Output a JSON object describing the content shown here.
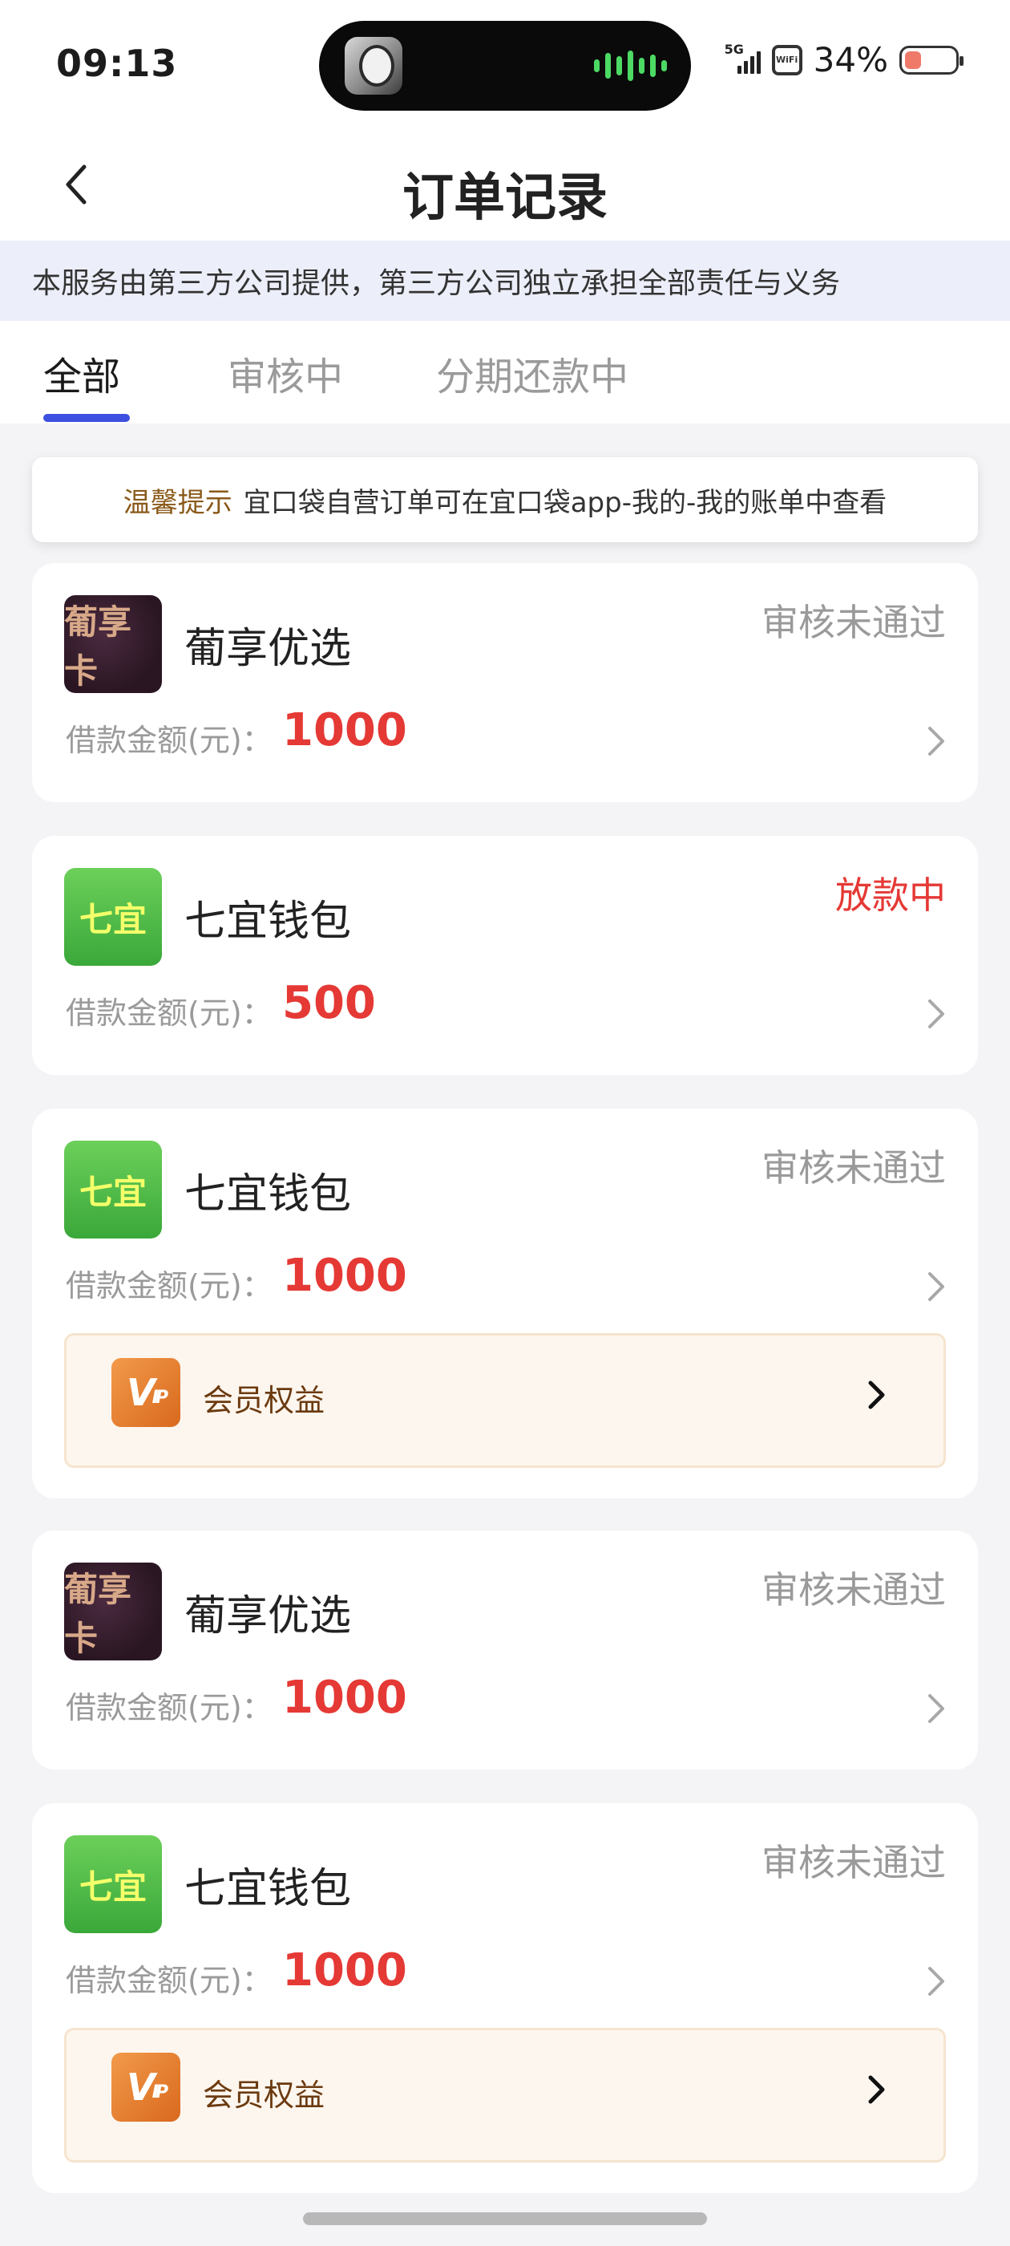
{
  "status_bar": {
    "time": "09:13",
    "network": "5G",
    "battery_pct": "34%",
    "battery_level": 0.34
  },
  "nav": {
    "title": "订单记录"
  },
  "notice": "本服务由第三方公司提供，第三方公司独立承担全部责任与义务",
  "tabs": [
    {
      "label": "全部",
      "active": true
    },
    {
      "label": "审核中",
      "active": false
    },
    {
      "label": "分期还款中",
      "active": false
    }
  ],
  "tip": {
    "label": "温馨提示",
    "text": "宜口袋自营订单可在宜口袋app-我的-我的账单中查看"
  },
  "orders": [
    {
      "logo_text": "葡享卡",
      "name": "葡享优选",
      "status": "审核未通过",
      "amount_label": "借款金额(元)：",
      "amount": "1000"
    },
    {
      "logo_text": "七宜",
      "name": "七宜钱包",
      "status": "放款中",
      "amount_label": "借款金额(元)：",
      "amount": "500"
    },
    {
      "logo_text": "七宜",
      "name": "七宜钱包",
      "status": "审核未通过",
      "amount_label": "借款金额(元)：",
      "amount": "1000",
      "vip": {
        "icon_text": "V",
        "icon_sub": "IP",
        "label": "会员权益"
      }
    },
    {
      "logo_text": "葡享卡",
      "name": "葡享优选",
      "status": "审核未通过",
      "amount_label": "借款金额(元)：",
      "amount": "1000"
    },
    {
      "logo_text": "七宜",
      "name": "七宜钱包",
      "status": "审核未通过",
      "amount_label": "借款金额(元)：",
      "amount": "1000",
      "vip": {
        "icon_text": "V",
        "icon_sub": "IP",
        "label": "会员权益"
      }
    }
  ],
  "colors": {
    "accent": "#3d50e0",
    "status_red": "#e53935",
    "amount_red": "#e53935",
    "tip_label": "#8a5a1a"
  }
}
